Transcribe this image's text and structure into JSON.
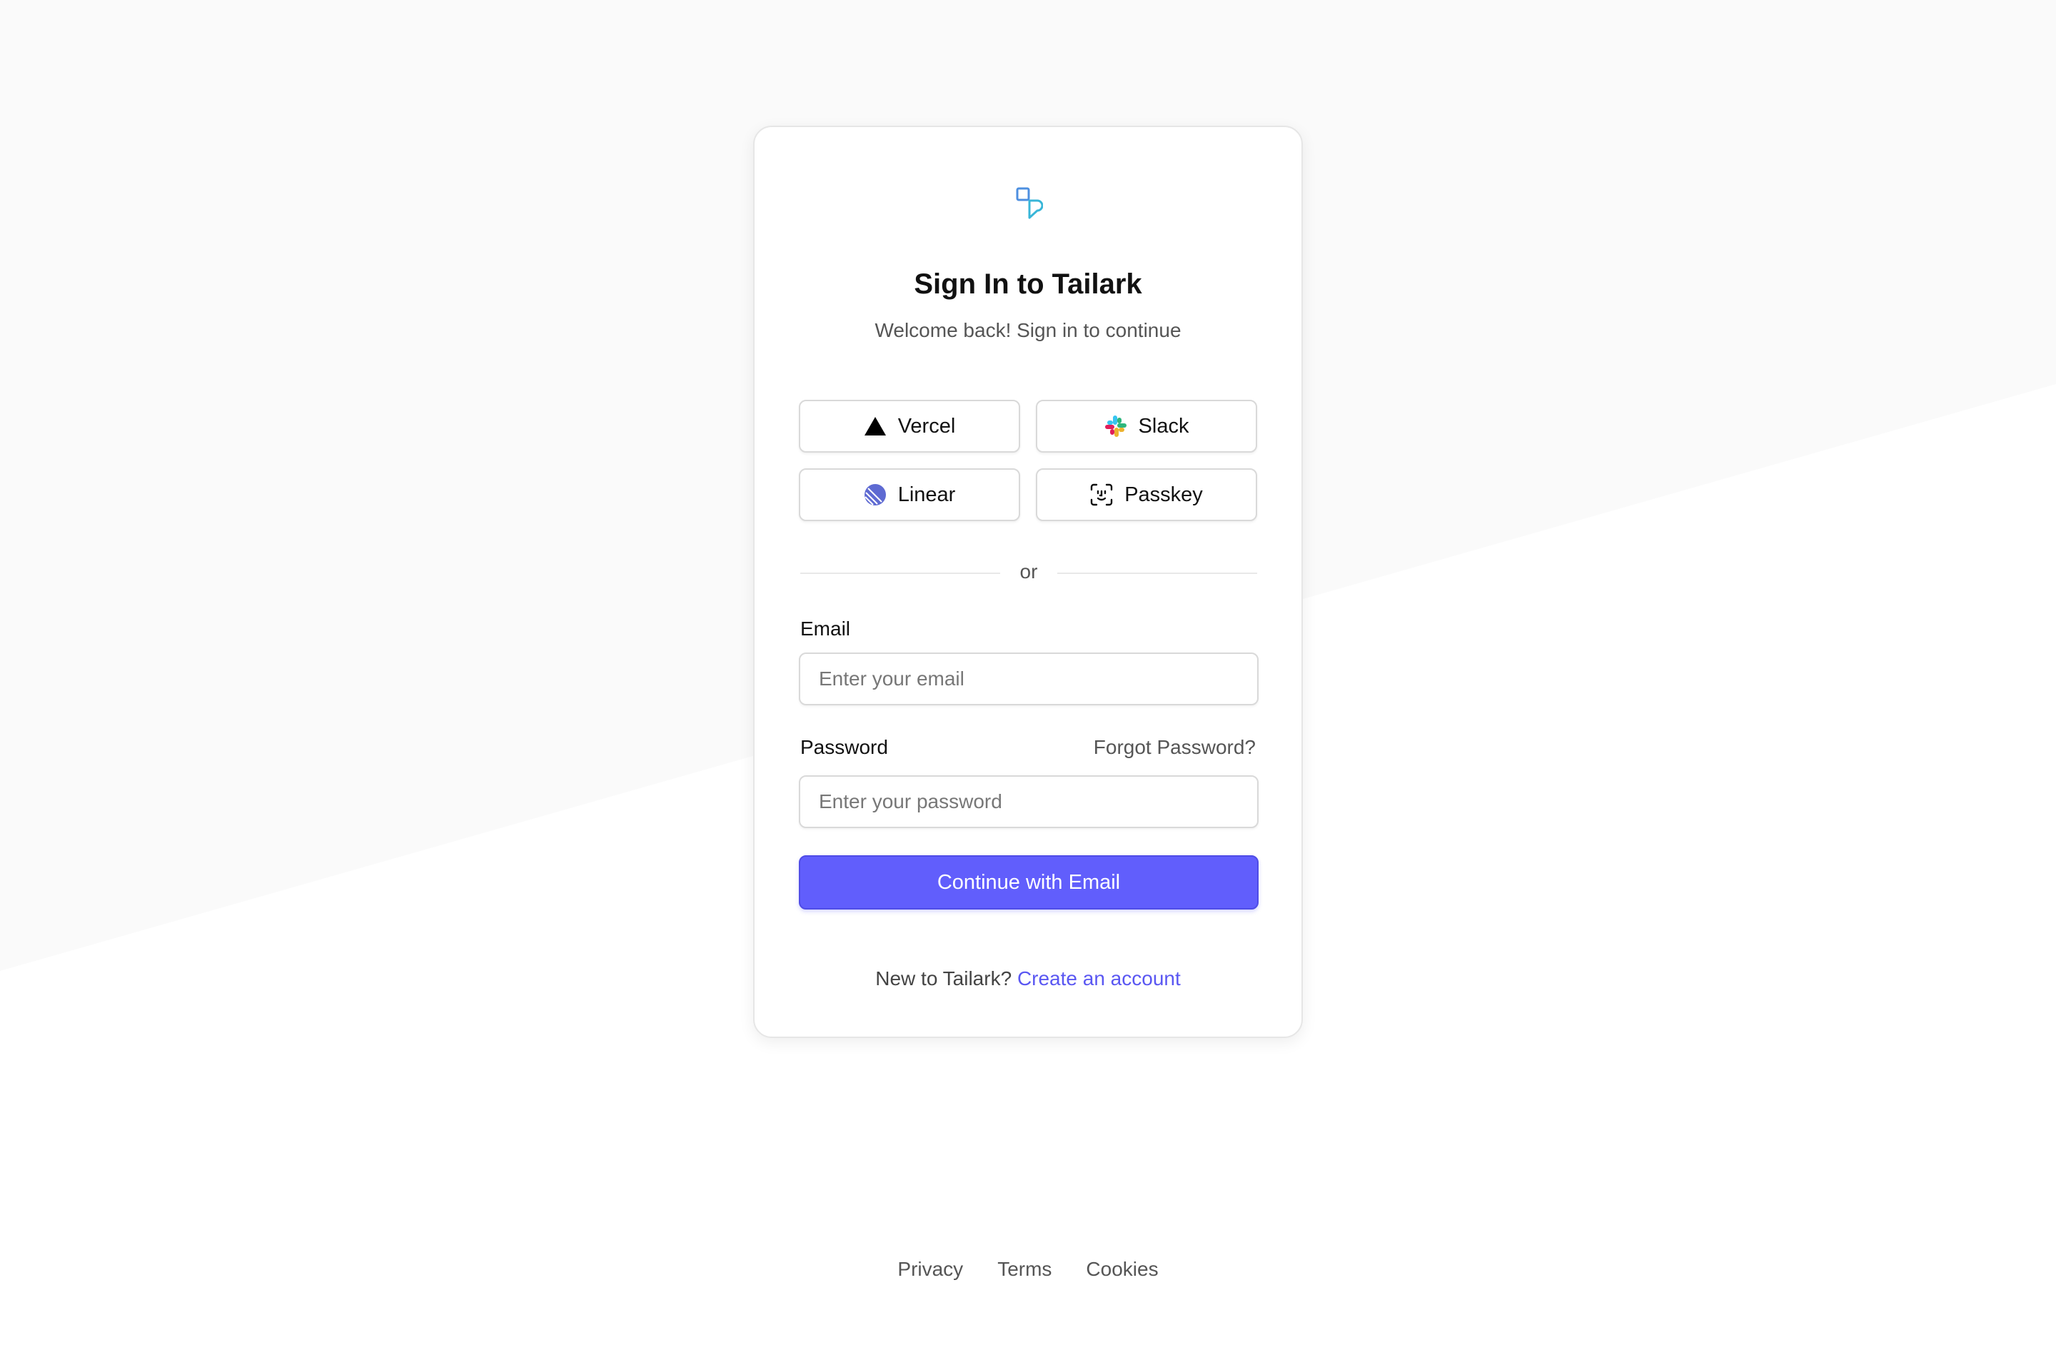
{
  "app": {
    "title": "Sign In to Tailark",
    "subtitle": "Welcome back! Sign in to continue"
  },
  "oauth": {
    "vercel": {
      "label": "Vercel",
      "icon": "vercel-triangle-icon"
    },
    "slack": {
      "label": "Slack",
      "icon": "slack-icon"
    },
    "linear": {
      "label": "Linear",
      "icon": "linear-icon"
    },
    "passkey": {
      "label": "Passkey",
      "icon": "face-scan-icon"
    }
  },
  "divider": {
    "label": "or"
  },
  "form": {
    "email_label": "Email",
    "email_placeholder": "Enter your email",
    "email_value": "",
    "password_label": "Password",
    "forgot_label": "Forgot Password?",
    "password_placeholder": "Enter your password",
    "password_value": "",
    "submit_label": "Continue with Email"
  },
  "signup": {
    "prompt": "New to Tailark?",
    "link_label": "Create an account"
  },
  "footer": {
    "privacy": "Privacy",
    "terms": "Terms",
    "cookies": "Cookies"
  },
  "colors": {
    "accent": "#615efc",
    "link": "#5a57f2",
    "background_shape": "#fafafa",
    "logo": "#3aa0e0"
  }
}
